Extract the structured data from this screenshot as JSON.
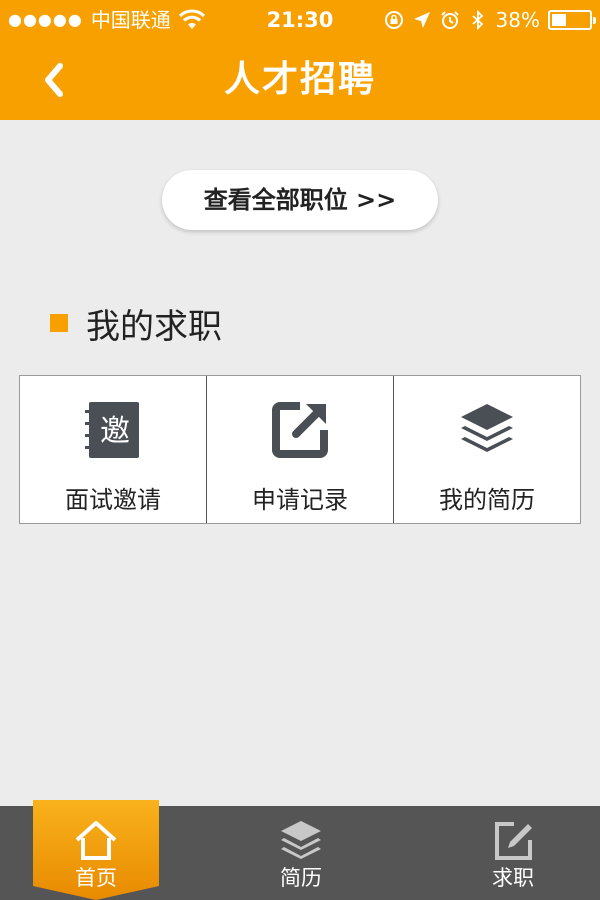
{
  "status_bar": {
    "signal": "●●●●●",
    "carrier": "中国联通",
    "time": "21:30",
    "battery": "38%",
    "battery_level": 0.38
  },
  "nav": {
    "title": "人才招聘",
    "back_icon": "chevron-left-icon"
  },
  "view_all_button": "查看全部职位 >>",
  "section": {
    "title": "我的求职"
  },
  "grid": [
    {
      "label": "面试邀请",
      "icon": "invitation-icon",
      "icon_text": "邀"
    },
    {
      "label": "申请记录",
      "icon": "share-out-icon"
    },
    {
      "label": "我的简历",
      "icon": "layers-icon"
    }
  ],
  "tabs": [
    {
      "label": "首页",
      "icon": "home-icon",
      "active": true
    },
    {
      "label": "简历",
      "icon": "layers-icon",
      "active": false
    },
    {
      "label": "求职",
      "icon": "edit-icon",
      "active": false
    }
  ],
  "colors": {
    "accent": "#f7a000",
    "background": "#ececec",
    "tab_bar": "#555555"
  }
}
